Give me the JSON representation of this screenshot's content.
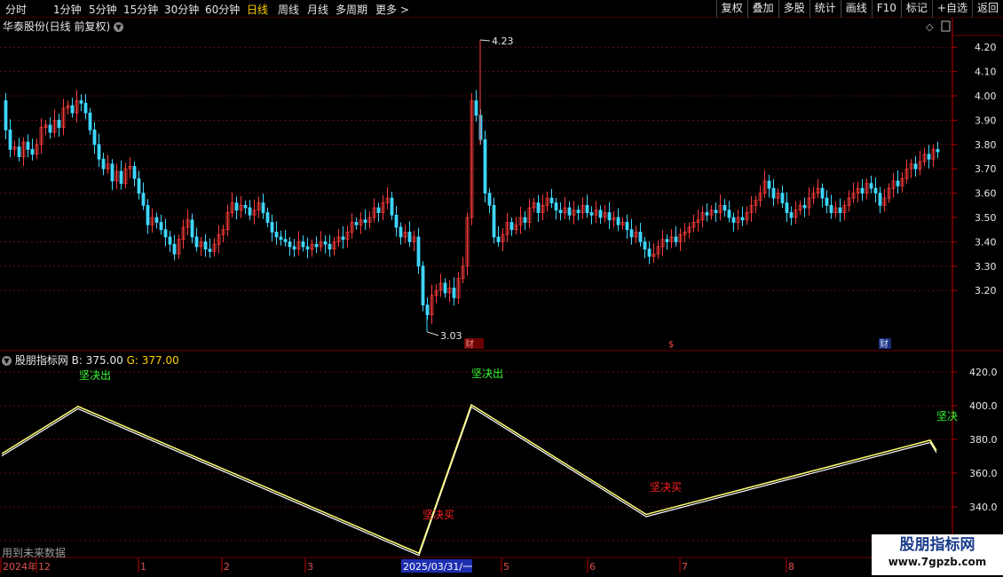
{
  "toolbar": {
    "periods": [
      "分时",
      "1分钟",
      "5分钟",
      "15分钟",
      "30分钟",
      "60分钟",
      "日线",
      "周线",
      "月线",
      "多周期",
      "更多 >"
    ],
    "active_period": "日线",
    "right_buttons": [
      "复权",
      "叠加",
      "多股",
      "统计",
      "画线",
      "F10",
      "标记",
      "+自选",
      "返回"
    ]
  },
  "main_chart": {
    "title": "华泰股份(日线 前复权)",
    "y_ticks": [
      "4.20",
      "4.10",
      "4.00",
      "3.90",
      "3.80",
      "3.70",
      "3.60",
      "3.50",
      "3.40",
      "3.30",
      "3.20"
    ],
    "high_label": "4.23",
    "low_label": "3.03",
    "markers": [
      "财",
      "$",
      "财"
    ],
    "colors": {
      "up": "#ff3b3b",
      "down": "#3fd6ff",
      "grid": "#7a1010",
      "axis": "#c00000"
    }
  },
  "indicator": {
    "name": "股朋指标网",
    "b_label": "B: 375.00",
    "g_label": "G: 377.00",
    "y_ticks": [
      "420.0",
      "400.0",
      "380.0",
      "360.0",
      "340.0"
    ],
    "sell_signals": [
      "坚决出",
      "坚决出",
      "坚决"
    ],
    "buy_signals": [
      "坚决买",
      "坚决买"
    ],
    "colors": {
      "line": "#ffff70",
      "sell": "#33ff33",
      "buy": "#ff2222"
    }
  },
  "x_axis": {
    "labels": [
      "2024年",
      "12",
      "1",
      "2",
      "3",
      "2025/03/31/一",
      "5",
      "6",
      "7",
      "8"
    ]
  },
  "footer_note": "用到未来数据",
  "watermark": {
    "title": "股朋指标网",
    "url": "www.7gpzb.com"
  }
}
